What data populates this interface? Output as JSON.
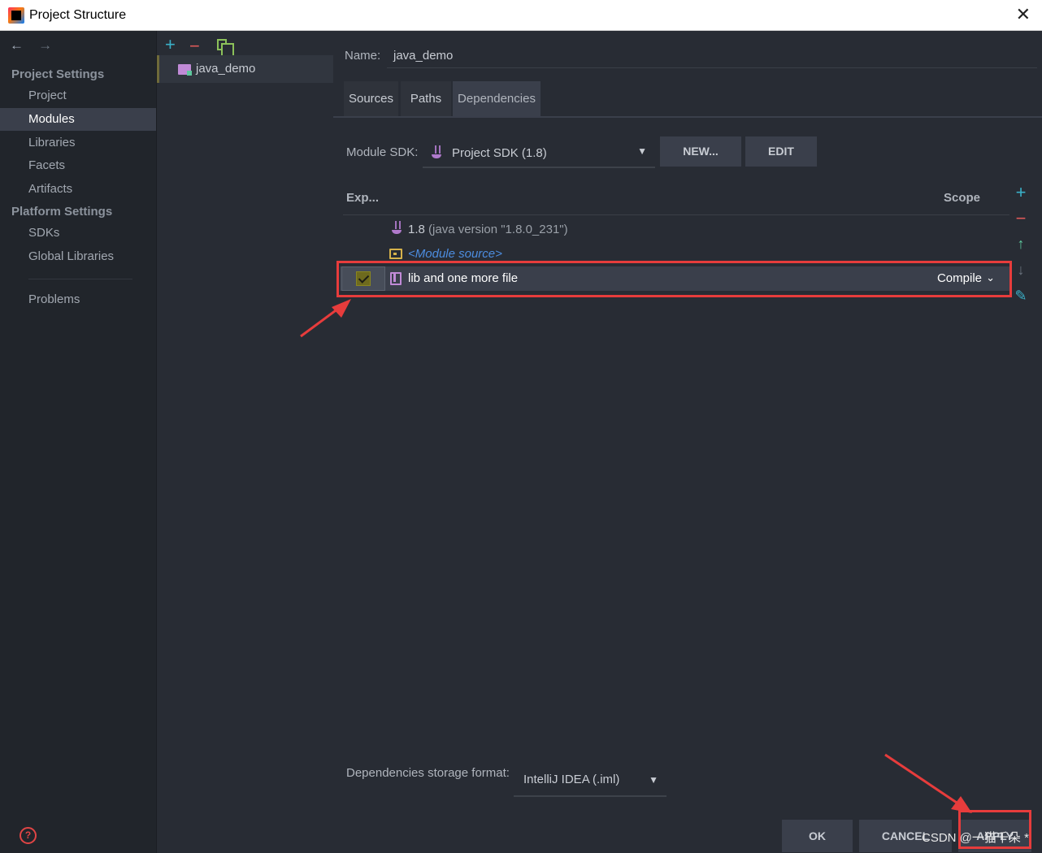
{
  "window": {
    "title": "Project Structure",
    "close_glyph": "✕"
  },
  "sidebar": {
    "back_icon": "←",
    "forward_icon": "→",
    "section_project": "Project Settings",
    "section_platform": "Platform Settings",
    "items": [
      {
        "label": "Project"
      },
      {
        "label": "Modules"
      },
      {
        "label": "Libraries"
      },
      {
        "label": "Facets"
      },
      {
        "label": "Artifacts"
      },
      {
        "label": "SDKs"
      },
      {
        "label": "Global Libraries"
      },
      {
        "label": "Problems"
      }
    ],
    "selected": "Modules",
    "help_glyph": "?"
  },
  "modules": {
    "add_glyph": "+",
    "remove_glyph": "−",
    "items": [
      {
        "label": "java_demo"
      }
    ]
  },
  "main": {
    "name_label": "Name:",
    "name_value": "java_demo",
    "tabs": [
      {
        "label": "Sources"
      },
      {
        "label": "Paths"
      },
      {
        "label": "Dependencies"
      }
    ],
    "active_tab": "Dependencies",
    "module_sdk_label": "Module SDK:",
    "module_sdk_value": "Project SDK (1.8)",
    "dropdown_glyph": "▼",
    "new_button": "NEW...",
    "edit_button": "EDIT",
    "columns": {
      "export": "Exp...",
      "scope": "Scope"
    },
    "dependencies": [
      {
        "name": "1.8",
        "detail": "(java version \"1.8.0_231\")"
      },
      {
        "name": "<Module source>"
      },
      {
        "name": "lib and one more file",
        "scope": "Compile",
        "exported": true
      }
    ],
    "scope_arrow_glyph": "⌄",
    "tools": {
      "add": "+",
      "remove": "−",
      "up": "↑",
      "down": "↓",
      "edit": "✎"
    },
    "storage_format_label": "Dependencies storage format:",
    "storage_format_value": "IntelliJ IDEA (.iml)"
  },
  "footer": {
    "ok_button": "OK",
    "cancel_button": "CANCEL",
    "apply_button": "APPLY",
    "watermark": "CSDN @一猫千朵 *"
  },
  "colors": {
    "background": "#282c34",
    "sidebar": "#21252b",
    "selection": "#3a3f4b",
    "annotation": "#e73c3c",
    "link": "#4c8de0"
  }
}
